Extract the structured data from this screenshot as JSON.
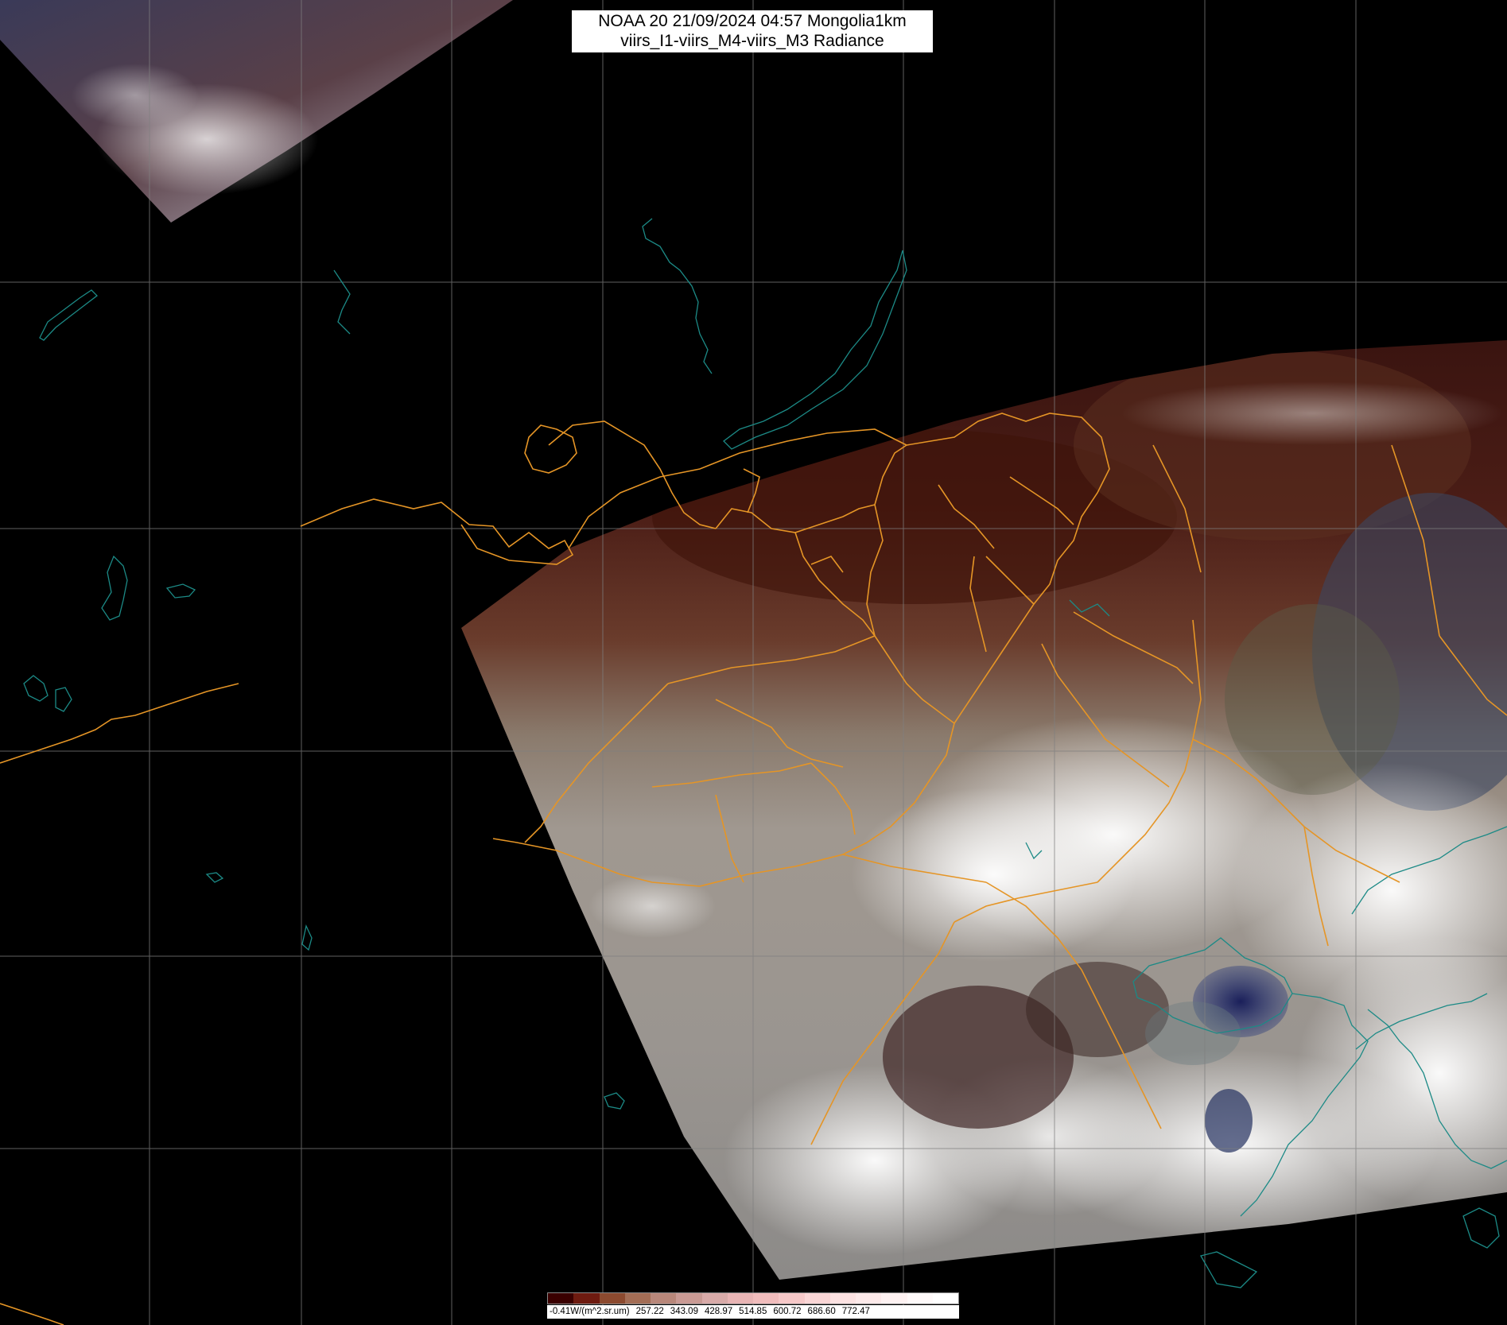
{
  "title": {
    "line1": "NOAA 20 21/09/2024 04:57 Mongolia1km",
    "line2": "viirs_I1-viirs_M4-viirs_M3 Radiance"
  },
  "legend": {
    "labels": [
      "-0.41W/(m^2.sr.um)",
      "257.22",
      "343.09",
      "428.97",
      "514.85",
      "600.72",
      "686.60",
      "772.47"
    ],
    "colors": [
      "#3a0000",
      "#6e1b10",
      "#8c4a2f",
      "#a36d55",
      "#b8877a",
      "#c99a94",
      "#d8aaa8",
      "#e8b4b4",
      "#f0bcbc",
      "#f6c8c8",
      "#fad6d6",
      "#fce2e2",
      "#fdeaea",
      "#fef2f2",
      "#fffafa",
      "#ffffff"
    ]
  },
  "colors": {
    "background": "#000000",
    "border": "#e59526",
    "coast": "#1c8a86",
    "grid": "#7f7f7f"
  }
}
